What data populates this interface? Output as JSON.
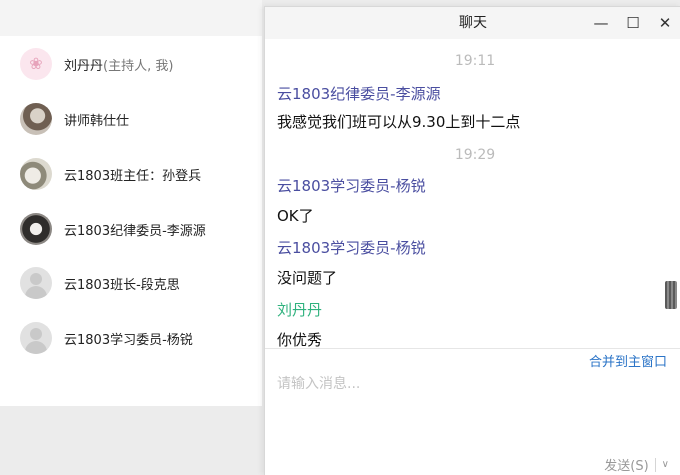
{
  "participants": [
    {
      "name": "刘丹丹",
      "role": "(主持人, 我)",
      "avatar_icon": "flower-avatar-icon"
    },
    {
      "name": "讲师韩仕仕",
      "role": "",
      "avatar_icon": "photo-avatar-icon"
    },
    {
      "name": "云1803班主任：孙登兵",
      "role": "",
      "avatar_icon": "photo-avatar-icon"
    },
    {
      "name": "云1803纪律委员-李源源",
      "role": "",
      "avatar_icon": "photo-avatar-icon"
    },
    {
      "name": "云1803班长-段克思",
      "role": "",
      "avatar_icon": "default-avatar-icon"
    },
    {
      "name": "云1803学习委员-杨锐",
      "role": "",
      "avatar_icon": "default-avatar-icon"
    }
  ],
  "chat": {
    "title": "聊天",
    "window_buttons": {
      "minimize": "—",
      "maximize": "☐",
      "close": "✕"
    },
    "messages": [
      {
        "type": "time",
        "text": "19:11"
      },
      {
        "type": "sender",
        "text": "云1803纪律委员-李源源",
        "self": false
      },
      {
        "type": "text",
        "text": "我感觉我们班可以从9.30上到十二点"
      },
      {
        "type": "time",
        "text": "19:29"
      },
      {
        "type": "sender",
        "text": "云1803学习委员-杨锐",
        "self": false
      },
      {
        "type": "text",
        "text": "OK了"
      },
      {
        "type": "sender",
        "text": "云1803学习委员-杨锐",
        "self": false
      },
      {
        "type": "text",
        "text": "没问题了"
      },
      {
        "type": "sender",
        "text": "刘丹丹",
        "self": true
      },
      {
        "type": "text",
        "text": "你优秀"
      }
    ],
    "merge_label": "合并到主窗口",
    "input_placeholder": "请输入消息...",
    "send_label": "发送(S)",
    "send_dropdown": "∨"
  },
  "colors": {
    "sender": "#4a4ea0",
    "self_sender": "#2fb27e",
    "link": "#2b74c7",
    "time": "#bbbbbb"
  }
}
